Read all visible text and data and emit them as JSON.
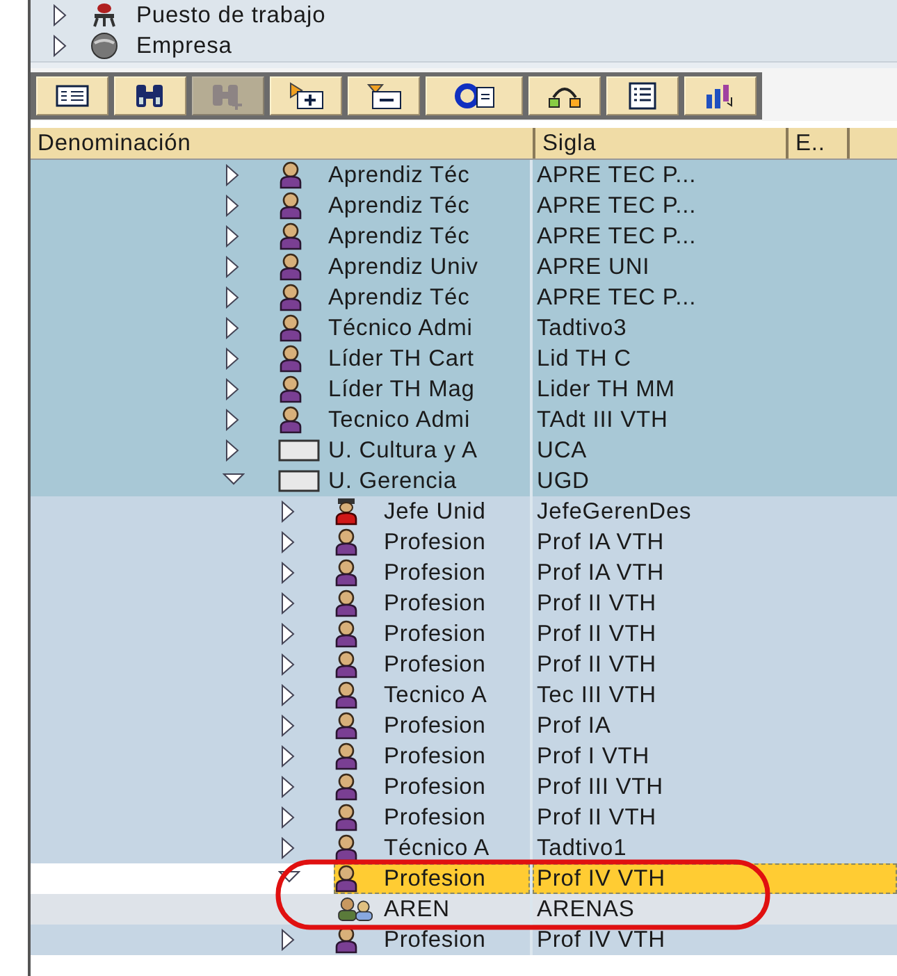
{
  "nav_panel": {
    "items": [
      {
        "label": "Puesto de trabajo",
        "kind": "position"
      },
      {
        "label": "Empresa",
        "kind": "company"
      }
    ]
  },
  "toolbar": [
    {
      "kind": "list",
      "disabled": false
    },
    {
      "kind": "find",
      "disabled": false
    },
    {
      "kind": "find-more",
      "disabled": true
    },
    {
      "kind": "expand",
      "disabled": false
    },
    {
      "kind": "collapse",
      "disabled": false
    },
    {
      "kind": "refresh",
      "disabled": false
    },
    {
      "kind": "split",
      "disabled": false
    },
    {
      "kind": "details",
      "disabled": false
    },
    {
      "kind": "columns",
      "disabled": false
    }
  ],
  "table": {
    "columns": [
      "Denominación",
      "Sigla",
      "E.."
    ],
    "tree": [
      {
        "label": "Aprendiz Téc",
        "sigla": "APRE TEC P...",
        "kind": "person",
        "expanded": false,
        "selected": false
      },
      {
        "label": "Aprendiz Téc",
        "sigla": "APRE TEC P...",
        "kind": "person",
        "expanded": false,
        "selected": false
      },
      {
        "label": "Aprendiz Téc",
        "sigla": "APRE TEC P...",
        "kind": "person",
        "expanded": false,
        "selected": false
      },
      {
        "label": "Aprendiz Univ",
        "sigla": "APRE UNI",
        "kind": "person",
        "expanded": false,
        "selected": false
      },
      {
        "label": "Aprendiz Téc",
        "sigla": "APRE TEC P...",
        "kind": "person",
        "expanded": false,
        "selected": false
      },
      {
        "label": "Técnico Admi",
        "sigla": "Tadtivo3",
        "kind": "person",
        "expanded": false,
        "selected": false
      },
      {
        "label": "Líder TH Cart",
        "sigla": "Lid TH C",
        "kind": "person",
        "expanded": false,
        "selected": false
      },
      {
        "label": "Líder TH Mag",
        "sigla": "Lider TH MM",
        "kind": "person",
        "expanded": false,
        "selected": false
      },
      {
        "label": "Tecnico Admi",
        "sigla": "TAdt III VTH",
        "kind": "person",
        "expanded": false,
        "selected": false
      },
      {
        "label": "U. Cultura y A",
        "sigla": "UCA",
        "kind": "unit",
        "expanded": false,
        "selected": false
      },
      {
        "label": "U. Gerencia",
        "sigla": "UGD",
        "kind": "unit",
        "expanded": true,
        "selected": false,
        "children": [
          {
            "label": "Jefe Unid",
            "sigla": "JefeGerenDes",
            "kind": "manager",
            "expanded": false,
            "selected": false
          },
          {
            "label": "Profesion",
            "sigla": "Prof IA VTH",
            "kind": "person",
            "expanded": false,
            "selected": false
          },
          {
            "label": "Profesion",
            "sigla": "Prof IA VTH",
            "kind": "person",
            "expanded": false,
            "selected": false
          },
          {
            "label": "Profesion",
            "sigla": "Prof II VTH",
            "kind": "person",
            "expanded": false,
            "selected": false
          },
          {
            "label": "Profesion",
            "sigla": "Prof II VTH",
            "kind": "person",
            "expanded": false,
            "selected": false
          },
          {
            "label": "Profesion",
            "sigla": "Prof II VTH",
            "kind": "person",
            "expanded": false,
            "selected": false
          },
          {
            "label": "Tecnico A",
            "sigla": "Tec III  VTH",
            "kind": "person",
            "expanded": false,
            "selected": false
          },
          {
            "label": "Profesion",
            "sigla": "Prof IA",
            "kind": "person",
            "expanded": false,
            "selected": false
          },
          {
            "label": "Profesion",
            "sigla": "Prof I VTH",
            "kind": "person",
            "expanded": false,
            "selected": false
          },
          {
            "label": "Profesion",
            "sigla": "Prof III VTH",
            "kind": "person",
            "expanded": false,
            "selected": false
          },
          {
            "label": "Profesion",
            "sigla": "Prof II VTH",
            "kind": "person",
            "expanded": false,
            "selected": false
          },
          {
            "label": "Técnico A",
            "sigla": "Tadtivo1",
            "kind": "person",
            "expanded": false,
            "selected": false
          },
          {
            "label": "Profesion",
            "sigla": "Prof IV VTH",
            "kind": "person",
            "expanded": true,
            "selected": true,
            "children": [
              {
                "label": "AREN",
                "sigla": "ARENAS",
                "kind": "holder",
                "selected": false
              }
            ]
          },
          {
            "label": "Profesion",
            "sigla": "Prof IV VTH",
            "kind": "person",
            "expanded": false,
            "selected": false
          }
        ]
      }
    ]
  }
}
